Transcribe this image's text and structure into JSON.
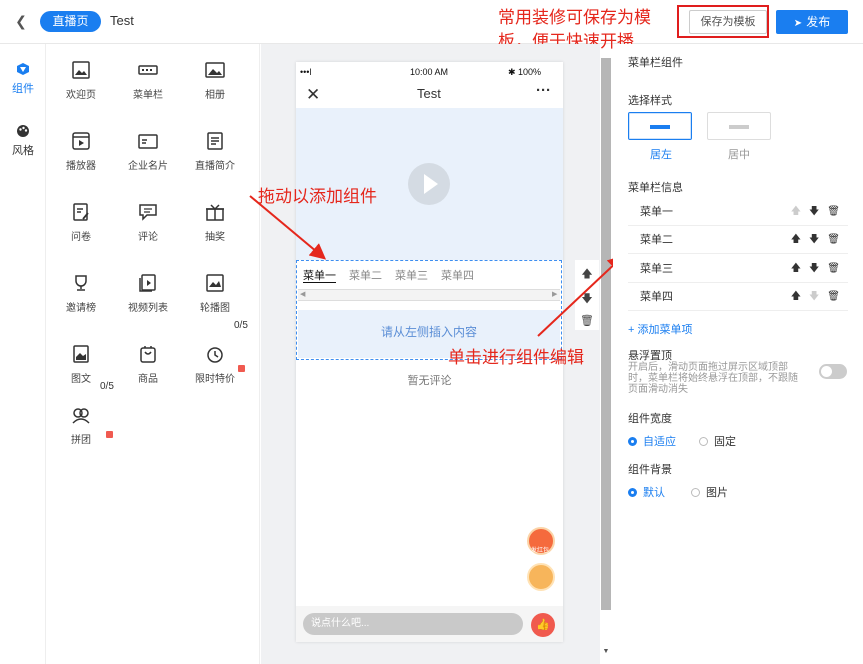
{
  "header": {
    "back_icon": "chevron-left-icon",
    "live_tag": "直播页",
    "title": "Test",
    "save_template": "保存为模板",
    "publish": "发布"
  },
  "annotations": {
    "top": "常用装修可保存为模板，便于快速开播",
    "drag": "拖动以添加组件",
    "click": "单击进行组件编辑"
  },
  "rail": [
    {
      "label": "组件",
      "icon": "component-icon",
      "active": true
    },
    {
      "label": "风格",
      "icon": "palette-icon",
      "active": false
    }
  ],
  "components": [
    {
      "label": "欢迎页",
      "icon": "image-icon"
    },
    {
      "label": "菜单栏",
      "icon": "menu-bar-icon"
    },
    {
      "label": "相册",
      "icon": "album-icon"
    },
    {
      "label": "播放器",
      "icon": "player-icon"
    },
    {
      "label": "企业名片",
      "icon": "business-card-icon"
    },
    {
      "label": "直播简介",
      "icon": "document-icon"
    },
    {
      "label": "问卷",
      "icon": "survey-icon"
    },
    {
      "label": "评论",
      "icon": "comment-icon"
    },
    {
      "label": "抽奖",
      "icon": "gift-icon"
    },
    {
      "label": "邀请榜",
      "icon": "trophy-icon"
    },
    {
      "label": "视频列表",
      "icon": "video-list-icon"
    },
    {
      "label": "轮播图",
      "icon": "carousel-icon"
    },
    {
      "label": "图文",
      "icon": "image-text-icon"
    },
    {
      "label": "商品",
      "icon": "goods-icon"
    },
    {
      "label": "限时特价",
      "icon": "timer-icon",
      "count": "0/5"
    },
    {
      "label": "拼团",
      "icon": "group-buy-icon",
      "count": "0/5"
    }
  ],
  "phone": {
    "signal": "•••l",
    "time": "10:00 AM",
    "battery": "✱ 100%",
    "title": "Test",
    "menu_tabs": [
      "菜单一",
      "菜单二",
      "菜单三",
      "菜单四"
    ],
    "insert_hint": "请从左侧插入内容",
    "no_comment": "暂无评论",
    "chat_placeholder": "说点什么吧...",
    "redpacket": "发红包"
  },
  "props": {
    "section_title": "菜单栏组件",
    "style_label": "选择样式",
    "styles": [
      "居左",
      "居中"
    ],
    "info_label": "菜单栏信息",
    "items": [
      "菜单一",
      "菜单二",
      "菜单三",
      "菜单四"
    ],
    "add_item": "+ 添加菜单项",
    "float_label": "悬浮置顶",
    "float_desc": "开启后，滑动页面拖过屏示区域顶部时，菜单栏将始终悬浮在顶部，不跟随页面滑动消失",
    "width_label": "组件宽度",
    "width_options": [
      "自适应",
      "固定"
    ],
    "bg_label": "组件背景",
    "bg_options": [
      "默认",
      "图片"
    ]
  }
}
